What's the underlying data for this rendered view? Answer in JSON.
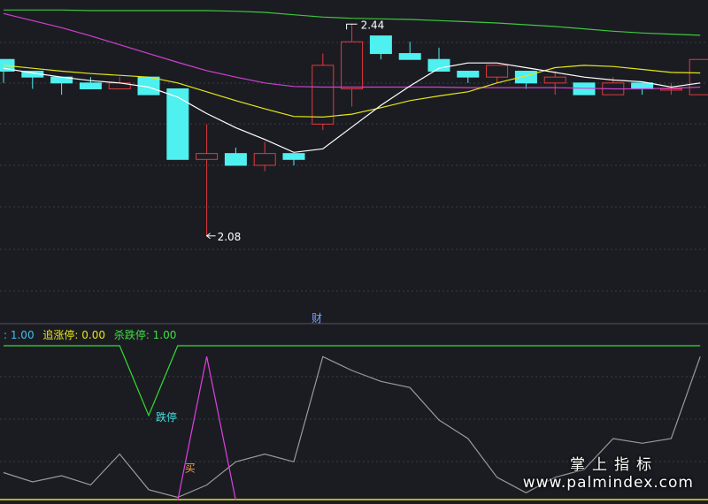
{
  "colors": {
    "background": "#1b1c22",
    "grid": "#3a3b45",
    "up": "#e0393e",
    "down": "#4ff0f0",
    "ma_white": "#ffffff",
    "ma_yellow": "#e6e617",
    "ma_magenta": "#d040d0",
    "ma_green": "#3ec83e",
    "osc_gray": "#9a9a9a",
    "osc_green": "#33dd33",
    "osc_magenta": "#e040e0",
    "osc_yellow": "#e6e617",
    "label_orange": "#f0a040",
    "label_cyan": "#40e0e0",
    "legend_cyan": "#40c0f0",
    "legend_yellow": "#e6e617",
    "legend_green": "#40e040",
    "annotation_white": "#ffffff",
    "annotation_blue": "#7aa0ff"
  },
  "chart_data": [
    {
      "type": "candlestick",
      "title": "",
      "ylim": [
        2.0,
        2.46
      ],
      "candles": [
        {
          "o": 2.38,
          "h": 2.38,
          "l": 2.34,
          "c": 2.36
        },
        {
          "o": 2.36,
          "h": 2.36,
          "l": 2.33,
          "c": 2.35
        },
        {
          "o": 2.35,
          "h": 2.35,
          "l": 2.32,
          "c": 2.34
        },
        {
          "o": 2.34,
          "h": 2.35,
          "l": 2.33,
          "c": 2.33
        },
        {
          "o": 2.33,
          "h": 2.35,
          "l": 2.33,
          "c": 2.34
        },
        {
          "o": 2.35,
          "h": 2.35,
          "l": 2.32,
          "c": 2.32
        },
        {
          "o": 2.33,
          "h": 2.33,
          "l": 2.21,
          "c": 2.21
        },
        {
          "o": 2.21,
          "h": 2.27,
          "l": 2.08,
          "c": 2.22
        },
        {
          "o": 2.22,
          "h": 2.23,
          "l": 2.2,
          "c": 2.2
        },
        {
          "o": 2.2,
          "h": 2.24,
          "l": 2.19,
          "c": 2.22
        },
        {
          "o": 2.22,
          "h": 2.22,
          "l": 2.2,
          "c": 2.21
        },
        {
          "o": 2.27,
          "h": 2.39,
          "l": 2.26,
          "c": 2.37
        },
        {
          "o": 2.33,
          "h": 2.44,
          "l": 2.3,
          "c": 2.41
        },
        {
          "o": 2.42,
          "h": 2.42,
          "l": 2.38,
          "c": 2.39
        },
        {
          "o": 2.39,
          "h": 2.41,
          "l": 2.38,
          "c": 2.38
        },
        {
          "o": 2.38,
          "h": 2.4,
          "l": 2.36,
          "c": 2.36
        },
        {
          "o": 2.36,
          "h": 2.36,
          "l": 2.34,
          "c": 2.35
        },
        {
          "o": 2.35,
          "h": 2.37,
          "l": 2.34,
          "c": 2.37
        },
        {
          "o": 2.36,
          "h": 2.36,
          "l": 2.33,
          "c": 2.34
        },
        {
          "o": 2.34,
          "h": 2.36,
          "l": 2.32,
          "c": 2.35
        },
        {
          "o": 2.34,
          "h": 2.34,
          "l": 2.32,
          "c": 2.32
        },
        {
          "o": 2.32,
          "h": 2.35,
          "l": 2.32,
          "c": 2.34
        },
        {
          "o": 2.34,
          "h": 2.34,
          "l": 2.32,
          "c": 2.33
        },
        {
          "o": 2.33,
          "h": 2.34,
          "l": 2.32,
          "c": 2.33
        },
        {
          "o": 2.32,
          "h": 2.38,
          "l": 2.32,
          "c": 2.38
        }
      ],
      "ma_white": [
        2.365,
        2.357,
        2.35,
        2.344,
        2.34,
        2.333,
        2.316,
        2.288,
        2.264,
        2.244,
        2.222,
        2.228,
        2.265,
        2.302,
        2.335,
        2.365,
        2.374,
        2.374,
        2.366,
        2.358,
        2.35,
        2.345,
        2.342,
        2.333,
        2.34
      ],
      "ma_yellow": [
        2.37,
        2.365,
        2.36,
        2.356,
        2.353,
        2.35,
        2.34,
        2.325,
        2.31,
        2.296,
        2.283,
        2.282,
        2.287,
        2.298,
        2.31,
        2.318,
        2.325,
        2.34,
        2.352,
        2.366,
        2.37,
        2.368,
        2.363,
        2.358,
        2.357
      ],
      "ma_magenta": [
        2.458,
        2.446,
        2.434,
        2.42,
        2.405,
        2.39,
        2.375,
        2.361,
        2.35,
        2.34,
        2.334,
        2.333,
        2.333,
        2.333,
        2.333,
        2.333,
        2.332,
        2.332,
        2.332,
        2.332,
        2.331,
        2.33,
        2.33,
        2.331,
        2.333
      ],
      "ma_green": [
        2.464,
        2.464,
        2.464,
        2.463,
        2.463,
        2.463,
        2.463,
        2.463,
        2.462,
        2.46,
        2.456,
        2.452,
        2.45,
        2.449,
        2.448,
        2.446,
        2.444,
        2.442,
        2.439,
        2.436,
        2.432,
        2.428,
        2.425,
        2.423,
        2.421
      ],
      "annotations": {
        "high_label": "2.44",
        "low_label": "2.08",
        "marker_label": "财"
      }
    },
    {
      "type": "line",
      "title": "",
      "ylim": [
        0,
        1
      ],
      "legend": [
        {
          "text": ": 1.00",
          "color": "#40c0f0"
        },
        {
          "text": "追涨停: 0.00",
          "color": "#e6e617"
        },
        {
          "text": "杀跌停: 1.00",
          "color": "#40e040"
        }
      ],
      "gray_series": [
        0.18,
        0.12,
        0.16,
        0.1,
        0.3,
        0.07,
        0.02,
        0.1,
        0.25,
        0.3,
        0.25,
        0.93,
        0.84,
        0.77,
        0.73,
        0.52,
        0.4,
        0.15,
        0.05,
        0.15,
        0.2,
        0.4,
        0.37,
        0.4,
        0.93
      ],
      "green_series": [
        1,
        1,
        1,
        1,
        1,
        0.55,
        1,
        1,
        1,
        1,
        1,
        1,
        1,
        1,
        1,
        1,
        1,
        1,
        1,
        1,
        1,
        1,
        1,
        1,
        1
      ],
      "magenta_spike": {
        "start_index": 6,
        "peak_index": 7,
        "end_index": 8,
        "peak": 0.93
      },
      "baseline": 0,
      "labels": {
        "die_ting": "跌停",
        "mai": "买"
      }
    }
  ],
  "watermark": {
    "line1": "掌上指标",
    "line2": "www.palmindex.com"
  }
}
